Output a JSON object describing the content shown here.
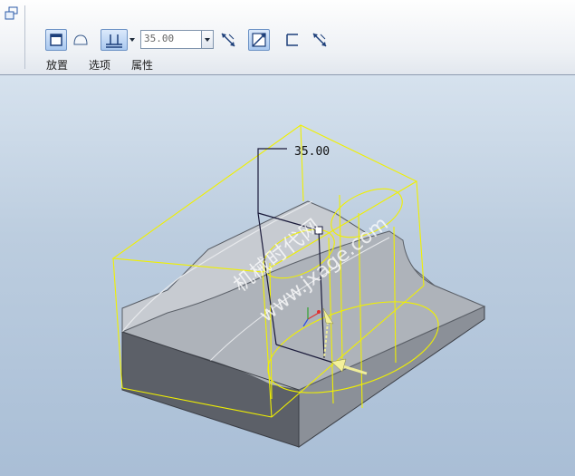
{
  "dashboard": {
    "tabs": [
      {
        "label": "放置"
      },
      {
        "label": "选项"
      },
      {
        "label": "属性"
      }
    ],
    "depth_value": "35.00",
    "icons": [
      "solid-icon",
      "surface-icon",
      "blind-depth-icon",
      "flip-direction-icon",
      "remove-material-icon",
      "thicken-icon",
      "flip-thicken-icon"
    ]
  },
  "viewport": {
    "dimension_label": "35.00",
    "watermark_line1": "机械时代网",
    "watermark_line2": "www.jxage.com"
  }
}
